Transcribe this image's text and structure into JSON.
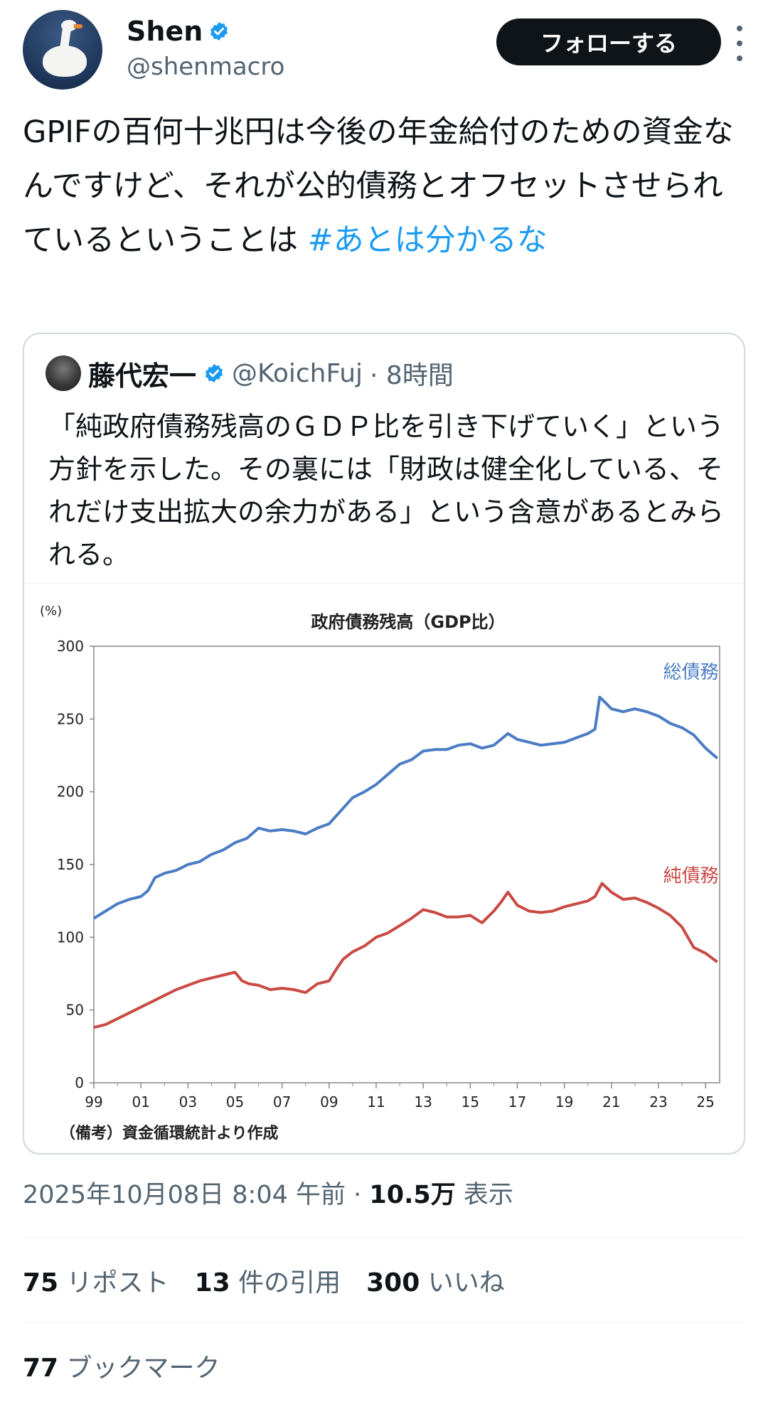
{
  "author": {
    "display_name": "Shen",
    "handle": "@shenmacro",
    "follow_label": "フォローする"
  },
  "tweet": {
    "text_main": "GPIFの百何十兆円は今後の年金給付のための資金なんですけど、それが公的債務とオフセットさせられているということは ",
    "hashtag": "#あとは分かるな"
  },
  "quote": {
    "display_name": "藤代宏一",
    "handle": "@KoichFuj",
    "time": "· 8時間",
    "text": "「純政府債務残高のＧＤＰ比を引き下げていく」という方針を示した。その裏には「財政は健全化している、それだけ支出拡大の余力がある」という含意があるとみられる。"
  },
  "chart_data": {
    "type": "line",
    "title": "政府債務残高（GDP比）",
    "ylabel": "(%)",
    "ylim": [
      0,
      300
    ],
    "yticks": [
      "0",
      "50",
      "100",
      "150",
      "200",
      "250",
      "300"
    ],
    "xlim": [
      1999,
      2025.6
    ],
    "xticks": [
      "99",
      "01",
      "03",
      "05",
      "07",
      "09",
      "11",
      "13",
      "15",
      "17",
      "19",
      "21",
      "23",
      "25"
    ],
    "note": "（備考）資金循環統計より作成",
    "grid": false,
    "series": [
      {
        "name": "総債務",
        "color": "#4b7cc4",
        "points": [
          [
            1999.0,
            113
          ],
          [
            1999.5,
            118
          ],
          [
            2000.0,
            123
          ],
          [
            2000.5,
            126
          ],
          [
            2001.0,
            128
          ],
          [
            2001.3,
            132
          ],
          [
            2001.6,
            141
          ],
          [
            2002.0,
            144
          ],
          [
            2002.5,
            146
          ],
          [
            2003.0,
            150
          ],
          [
            2003.5,
            152
          ],
          [
            2004.0,
            157
          ],
          [
            2004.5,
            160
          ],
          [
            2005.0,
            165
          ],
          [
            2005.5,
            168
          ],
          [
            2006.0,
            175
          ],
          [
            2006.5,
            173
          ],
          [
            2007.0,
            174
          ],
          [
            2007.5,
            173
          ],
          [
            2008.0,
            171
          ],
          [
            2008.5,
            175
          ],
          [
            2009.0,
            178
          ],
          [
            2009.5,
            187
          ],
          [
            2010.0,
            196
          ],
          [
            2010.5,
            200
          ],
          [
            2011.0,
            205
          ],
          [
            2011.5,
            212
          ],
          [
            2012.0,
            219
          ],
          [
            2012.5,
            222
          ],
          [
            2013.0,
            228
          ],
          [
            2013.5,
            229
          ],
          [
            2014.0,
            229
          ],
          [
            2014.5,
            232
          ],
          [
            2015.0,
            233
          ],
          [
            2015.5,
            230
          ],
          [
            2016.0,
            232
          ],
          [
            2016.3,
            236
          ],
          [
            2016.6,
            240
          ],
          [
            2017.0,
            236
          ],
          [
            2017.5,
            234
          ],
          [
            2018.0,
            232
          ],
          [
            2018.5,
            233
          ],
          [
            2019.0,
            234
          ],
          [
            2019.5,
            237
          ],
          [
            2020.0,
            240
          ],
          [
            2020.3,
            243
          ],
          [
            2020.5,
            265
          ],
          [
            2020.7,
            262
          ],
          [
            2021.0,
            257
          ],
          [
            2021.5,
            255
          ],
          [
            2022.0,
            257
          ],
          [
            2022.5,
            255
          ],
          [
            2023.0,
            252
          ],
          [
            2023.5,
            247
          ],
          [
            2024.0,
            244
          ],
          [
            2024.5,
            239
          ],
          [
            2025.0,
            230
          ],
          [
            2025.5,
            223
          ]
        ]
      },
      {
        "name": "純債務",
        "color": "#c94a45",
        "points": [
          [
            1999.0,
            38
          ],
          [
            1999.5,
            40
          ],
          [
            2000.0,
            44
          ],
          [
            2000.5,
            48
          ],
          [
            2001.0,
            52
          ],
          [
            2001.5,
            56
          ],
          [
            2002.0,
            60
          ],
          [
            2002.5,
            64
          ],
          [
            2003.0,
            67
          ],
          [
            2003.5,
            70
          ],
          [
            2004.0,
            72
          ],
          [
            2004.5,
            74
          ],
          [
            2005.0,
            76
          ],
          [
            2005.3,
            70
          ],
          [
            2005.6,
            68
          ],
          [
            2006.0,
            67
          ],
          [
            2006.5,
            64
          ],
          [
            2007.0,
            65
          ],
          [
            2007.5,
            64
          ],
          [
            2008.0,
            62
          ],
          [
            2008.5,
            68
          ],
          [
            2009.0,
            70
          ],
          [
            2009.3,
            78
          ],
          [
            2009.6,
            85
          ],
          [
            2010.0,
            90
          ],
          [
            2010.5,
            94
          ],
          [
            2011.0,
            100
          ],
          [
            2011.5,
            103
          ],
          [
            2012.0,
            108
          ],
          [
            2012.5,
            113
          ],
          [
            2013.0,
            119
          ],
          [
            2013.5,
            117
          ],
          [
            2014.0,
            114
          ],
          [
            2014.5,
            114
          ],
          [
            2015.0,
            115
          ],
          [
            2015.5,
            110
          ],
          [
            2016.0,
            118
          ],
          [
            2016.3,
            124
          ],
          [
            2016.6,
            131
          ],
          [
            2017.0,
            122
          ],
          [
            2017.5,
            118
          ],
          [
            2018.0,
            117
          ],
          [
            2018.5,
            118
          ],
          [
            2019.0,
            121
          ],
          [
            2019.5,
            123
          ],
          [
            2020.0,
            125
          ],
          [
            2020.3,
            128
          ],
          [
            2020.6,
            137
          ],
          [
            2021.0,
            131
          ],
          [
            2021.5,
            126
          ],
          [
            2022.0,
            127
          ],
          [
            2022.5,
            124
          ],
          [
            2023.0,
            120
          ],
          [
            2023.5,
            115
          ],
          [
            2024.0,
            107
          ],
          [
            2024.5,
            93
          ],
          [
            2025.0,
            89
          ],
          [
            2025.5,
            83
          ]
        ]
      }
    ]
  },
  "meta": {
    "timestamp": "2025年10月08日 8:04 午前 · ",
    "views_count": "10.5万",
    "views_label": " 表示"
  },
  "stats": {
    "reposts_count": "75",
    "reposts_label": " リポスト",
    "quotes_count": "13",
    "quotes_label": " 件の引用",
    "likes_count": "300",
    "likes_label": " いいね",
    "bookmarks_count": "77",
    "bookmarks_label": " ブックマーク"
  }
}
